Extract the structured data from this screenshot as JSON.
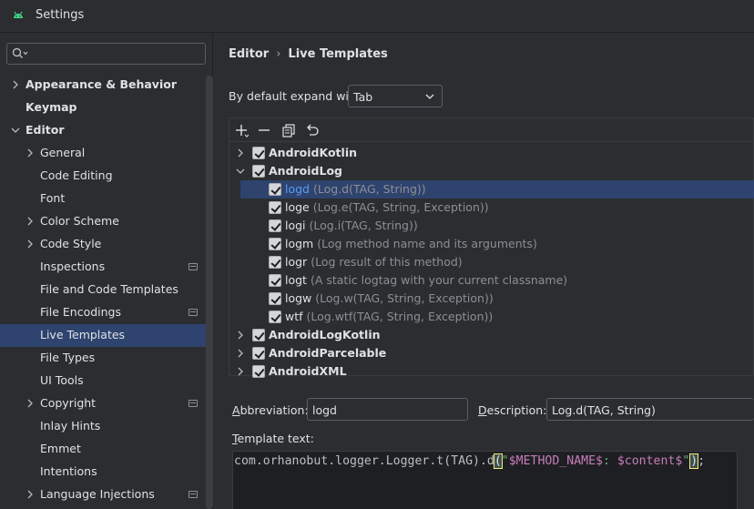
{
  "window": {
    "title": "Settings"
  },
  "search": {
    "placeholder": ""
  },
  "sidebar": {
    "items": [
      {
        "label": "Appearance & Behavior",
        "bold": true,
        "chevron": "right",
        "level": 0
      },
      {
        "label": "Keymap",
        "bold": true,
        "chevron": "none",
        "level": 0
      },
      {
        "label": "Editor",
        "bold": true,
        "chevron": "down",
        "level": 0
      },
      {
        "label": "General",
        "bold": false,
        "chevron": "right",
        "level": 1
      },
      {
        "label": "Code Editing",
        "bold": false,
        "chevron": "none",
        "level": 1
      },
      {
        "label": "Font",
        "bold": false,
        "chevron": "none",
        "level": 1
      },
      {
        "label": "Color Scheme",
        "bold": false,
        "chevron": "right",
        "level": 1
      },
      {
        "label": "Code Style",
        "bold": false,
        "chevron": "right",
        "level": 1
      },
      {
        "label": "Inspections",
        "bold": false,
        "chevron": "none",
        "level": 1,
        "badge": true
      },
      {
        "label": "File and Code Templates",
        "bold": false,
        "chevron": "none",
        "level": 1
      },
      {
        "label": "File Encodings",
        "bold": false,
        "chevron": "none",
        "level": 1,
        "badge": true
      },
      {
        "label": "Live Templates",
        "bold": false,
        "chevron": "none",
        "level": 1,
        "selected": true
      },
      {
        "label": "File Types",
        "bold": false,
        "chevron": "none",
        "level": 1
      },
      {
        "label": "UI Tools",
        "bold": false,
        "chevron": "none",
        "level": 1
      },
      {
        "label": "Copyright",
        "bold": false,
        "chevron": "right",
        "level": 1,
        "badge": true
      },
      {
        "label": "Inlay Hints",
        "bold": false,
        "chevron": "none",
        "level": 1
      },
      {
        "label": "Emmet",
        "bold": false,
        "chevron": "none",
        "level": 1
      },
      {
        "label": "Intentions",
        "bold": false,
        "chevron": "none",
        "level": 1
      },
      {
        "label": "Language Injections",
        "bold": false,
        "chevron": "right",
        "level": 1,
        "badge": true
      }
    ]
  },
  "breadcrumb": {
    "parent": "Editor",
    "current": "Live Templates"
  },
  "expand": {
    "label": "By default expand with",
    "value": "Tab"
  },
  "toolbar": {
    "icons": [
      "add-icon",
      "remove-icon",
      "duplicate-icon",
      "restore-icon"
    ]
  },
  "templates": {
    "rows": [
      {
        "kind": "group",
        "name": "AndroidKotlin",
        "expanded": false
      },
      {
        "kind": "group",
        "name": "AndroidLog",
        "expanded": true
      },
      {
        "kind": "item",
        "abbr": "logd",
        "desc": "(Log.d(TAG, String))",
        "selected": true
      },
      {
        "kind": "item",
        "abbr": "loge",
        "desc": "(Log.e(TAG, String, Exception))"
      },
      {
        "kind": "item",
        "abbr": "logi",
        "desc": "(Log.i(TAG, String))"
      },
      {
        "kind": "item",
        "abbr": "logm",
        "desc": "(Log method name and its arguments)"
      },
      {
        "kind": "item",
        "abbr": "logr",
        "desc": "(Log result of this method)"
      },
      {
        "kind": "item",
        "abbr": "logt",
        "desc": "(A static logtag with your current classname)"
      },
      {
        "kind": "item",
        "abbr": "logw",
        "desc": "(Log.w(TAG, String, Exception))"
      },
      {
        "kind": "item",
        "abbr": "wtf",
        "desc": "(Log.wtf(TAG, String, Exception))"
      },
      {
        "kind": "group",
        "name": "AndroidLogKotlin",
        "expanded": false
      },
      {
        "kind": "group",
        "name": "AndroidParcelable",
        "expanded": false
      },
      {
        "kind": "group",
        "name": "AndroidXML",
        "expanded": false
      }
    ]
  },
  "abbreviation": {
    "label_prefix": "A",
    "label_rest": "bbreviation:",
    "value": "logd"
  },
  "description": {
    "label_prefix": "D",
    "label_rest": "escription:",
    "value": "Log.d(TAG, String)"
  },
  "template_text": {
    "label_prefix": "T",
    "label_rest": "emplate text:",
    "code_prefix": "com.orhanobut.logger.Logger.t(TAG).d",
    "paren_open": "(",
    "q1": "\"",
    "var1": "$METHOD_NAME$",
    "mid": ": ",
    "var2": "$content$",
    "q2": "\"",
    "paren_close": ")",
    "suffix": ";"
  },
  "colors": {
    "background": "#2b2d30",
    "selection": "#2e436e",
    "accent": "#589df6",
    "string": "#6aab73",
    "template_var": "#c77dbb"
  }
}
